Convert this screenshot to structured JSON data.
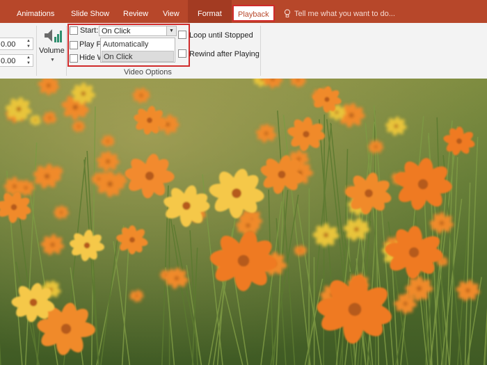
{
  "tabs": {
    "animations": "Animations",
    "slide_show": "Slide Show",
    "review": "Review",
    "view": "View",
    "format": "Format",
    "playback": "Playback"
  },
  "tell_me": {
    "icon": "lightbulb-icon",
    "text": "Tell me what you want to do..."
  },
  "ribbon": {
    "spin_values": [
      "0.00",
      "0.00"
    ],
    "volume": {
      "label": "Volume",
      "icon": "speaker-volume-icon"
    },
    "video_options": {
      "group_label": "Video Options",
      "start_label": "Start:",
      "start_value": "On Click",
      "start_options": [
        "Automatically",
        "On Click"
      ],
      "play_full_screen_label": "Play Fu",
      "hide_while_not_playing_label": "Hide W",
      "loop_label": "Loop until Stopped",
      "rewind_label": "Rewind after Playing"
    }
  },
  "colors": {
    "tab_bar": "#b7472a",
    "highlight_box": "#d02a2a",
    "ribbon_bg": "#f3f3f3"
  }
}
